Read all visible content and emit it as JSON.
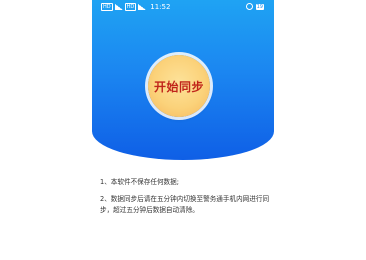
{
  "status_bar": {
    "signal_labels": [
      "HD",
      "HD"
    ],
    "time": "11:52",
    "battery": "19"
  },
  "main": {
    "start_button_label": "开始同步"
  },
  "notes": [
    "1、本软件不保存任何数据;",
    "2、数据同步后请在五分钟内切换至警务通手机内网进行同步，超过五分钟后数据自动清除。"
  ],
  "colors": {
    "hero_top": "#1fa3f3",
    "hero_bottom": "#0f5fe6",
    "button_fill": "#fbd27a",
    "button_text": "#c0251a",
    "note_text": "#333333"
  }
}
